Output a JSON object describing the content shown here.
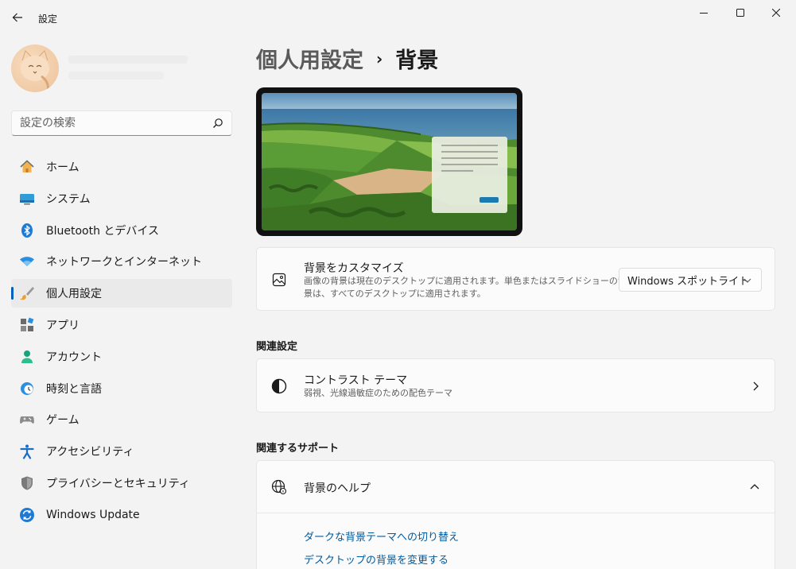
{
  "window": {
    "title": "設定"
  },
  "search": {
    "placeholder": "設定の検索"
  },
  "sidebar": {
    "items": [
      {
        "label": "ホーム",
        "icon": "home-icon"
      },
      {
        "label": "システム",
        "icon": "monitor-icon"
      },
      {
        "label": "Bluetooth とデバイス",
        "icon": "bluetooth-icon"
      },
      {
        "label": "ネットワークとインターネット",
        "icon": "wifi-icon"
      },
      {
        "label": "個人用設定",
        "icon": "brush-icon",
        "active": true
      },
      {
        "label": "アプリ",
        "icon": "apps-icon"
      },
      {
        "label": "アカウント",
        "icon": "person-icon"
      },
      {
        "label": "時刻と言語",
        "icon": "clock-globe-icon"
      },
      {
        "label": "ゲーム",
        "icon": "gamepad-icon"
      },
      {
        "label": "アクセシビリティ",
        "icon": "accessibility-icon"
      },
      {
        "label": "プライバシーとセキュリティ",
        "icon": "shield-icon"
      },
      {
        "label": "Windows Update",
        "icon": "update-icon"
      }
    ]
  },
  "header": {
    "parent": "個人用設定",
    "separator": "›",
    "current": "背景"
  },
  "customize": {
    "title": "背景をカスタマイズ",
    "desc_line1": "画像の背景は現在のデスクトップに適用されます。単色またはスライドショーの背",
    "desc_line2": "景は、すべてのデスクトップに適用されます。",
    "dropdown_value": "Windows スポットライト"
  },
  "related_settings": {
    "label": "関連設定",
    "contrast_title": "コントラスト テーマ",
    "contrast_desc": "弱視、光線過敏症のための配色テーマ"
  },
  "related_support": {
    "label": "関連するサポート",
    "help_title": "背景のヘルプ",
    "links": [
      "ダークな背景テーマへの切り替え",
      "デスクトップの背景を変更する"
    ]
  },
  "colors": {
    "accent": "#005fb8",
    "link": "#005a9e",
    "background": "#f3f3f3",
    "card": "#fbfbfb"
  }
}
